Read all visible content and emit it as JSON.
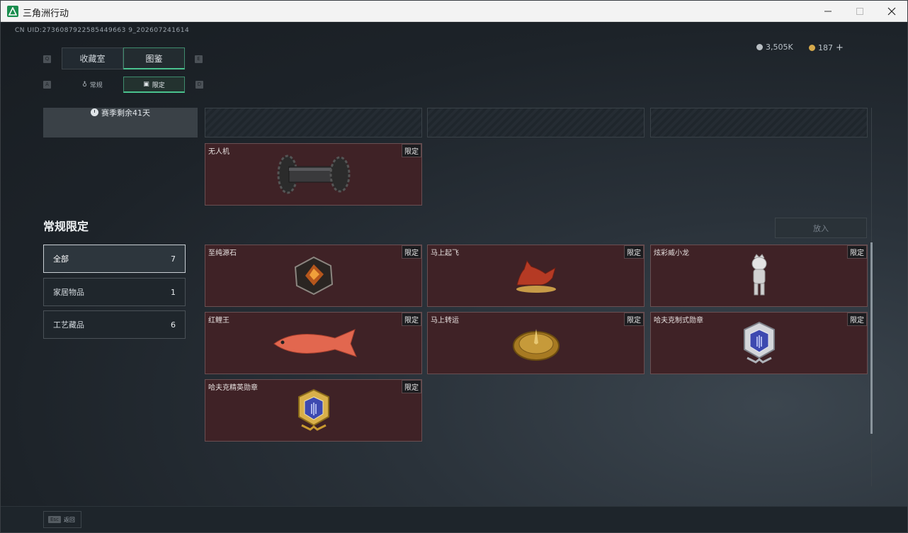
{
  "window": {
    "title": "三角洲行动"
  },
  "header": {
    "uid": "CN UID:2736087922585449663 9_202607241614",
    "currency": [
      {
        "icon": "silver-coin-icon",
        "value": "3,505K"
      },
      {
        "icon": "gold-coin-icon",
        "value": "187"
      }
    ],
    "plus_label": "+"
  },
  "tabs": {
    "main": [
      {
        "label": "收藏室",
        "active": false
      },
      {
        "label": "图鉴",
        "active": true
      }
    ],
    "sub": [
      {
        "label": "常规",
        "icon": "flame-icon",
        "active": false
      },
      {
        "label": "限定",
        "icon": "image-icon",
        "active": true
      }
    ],
    "key_hints": [
      "Q",
      "E",
      "A",
      "D"
    ]
  },
  "season": {
    "text": "赛季剩余41天"
  },
  "limited_top": {
    "items": [
      {
        "name": "无人机",
        "badge": "限定",
        "icon": "drone-item-icon"
      }
    ]
  },
  "section": {
    "title": "常规限定"
  },
  "filters": [
    {
      "label": "全部",
      "count": "7",
      "active": true
    },
    {
      "label": "家居物品",
      "count": "1",
      "active": false
    },
    {
      "label": "工艺藏品",
      "count": "6",
      "active": false
    }
  ],
  "release_button": {
    "label": "放入"
  },
  "items": [
    {
      "name": "至纯源石",
      "badge": "限定",
      "icon": "gem-item-icon"
    },
    {
      "name": "马上起飞",
      "badge": "限定",
      "icon": "horse-item-icon"
    },
    {
      "name": "炫彩威小龙",
      "badge": "限定",
      "icon": "figure-item-icon"
    },
    {
      "name": "红鲤王",
      "badge": "限定",
      "icon": "fish-item-icon"
    },
    {
      "name": "马上转运",
      "badge": "限定",
      "icon": "compass-item-icon"
    },
    {
      "name": "哈夫克制式勋章",
      "badge": "限定",
      "icon": "silver-medal-icon"
    },
    {
      "name": "哈夫克精英勋章",
      "badge": "限定",
      "icon": "gold-medal-icon"
    }
  ],
  "bottom": {
    "esc_key": "Esc",
    "back_label": "返回"
  },
  "colors": {
    "accent": "#4ac28e",
    "card_bg": "#3f2226",
    "card_border": "#6a4f52"
  }
}
